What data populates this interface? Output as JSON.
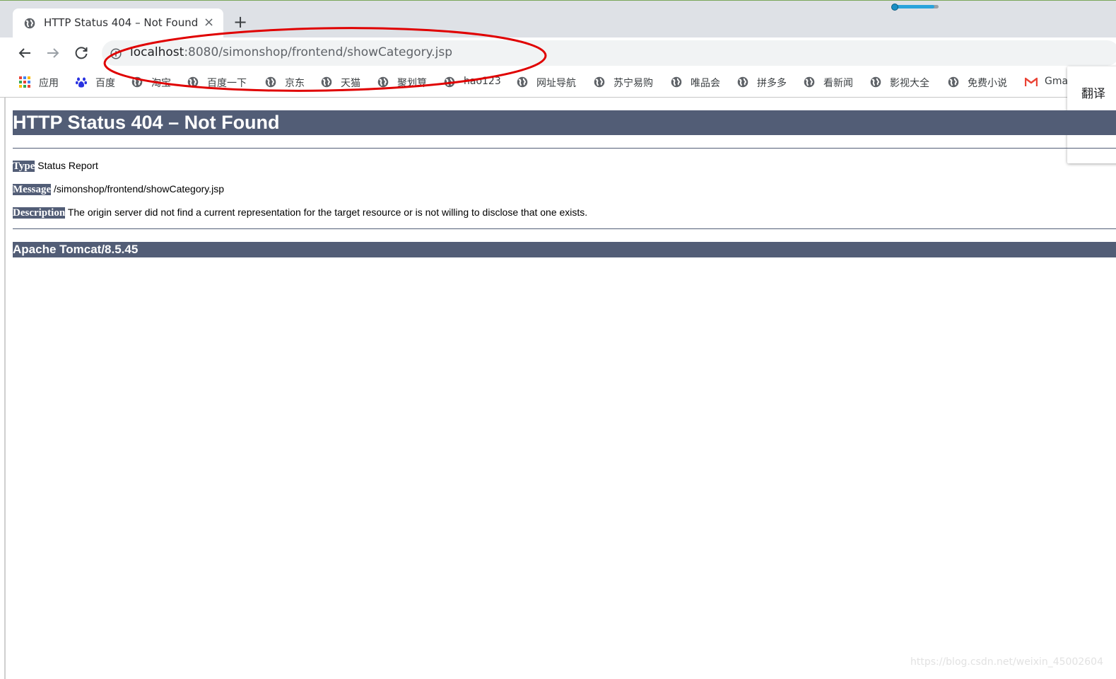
{
  "tab": {
    "title": "HTTP Status 404 – Not Found",
    "close": "×",
    "new_tab": "+"
  },
  "address": {
    "host": "localhost",
    "rest": ":8080/simonshop/frontend/showCategory.jsp"
  },
  "bookmarks": [
    {
      "label": "应用",
      "icon": "apps-grid-icon"
    },
    {
      "label": "百度",
      "icon": "baidu-paw-icon"
    },
    {
      "label": "淘宝",
      "icon": "globe-icon"
    },
    {
      "label": "百度一下",
      "icon": "globe-icon"
    },
    {
      "label": "京东",
      "icon": "globe-icon"
    },
    {
      "label": "天猫",
      "icon": "globe-icon"
    },
    {
      "label": "聚划算",
      "icon": "globe-icon"
    },
    {
      "label": "hao123",
      "icon": "globe-icon"
    },
    {
      "label": "网址导航",
      "icon": "globe-icon"
    },
    {
      "label": "苏宁易购",
      "icon": "globe-icon"
    },
    {
      "label": "唯品会",
      "icon": "globe-icon"
    },
    {
      "label": "拼多多",
      "icon": "globe-icon"
    },
    {
      "label": "看新闻",
      "icon": "globe-icon"
    },
    {
      "label": "影视大全",
      "icon": "globe-icon"
    },
    {
      "label": "免费小说",
      "icon": "globe-icon"
    },
    {
      "label": "Gmail",
      "icon": "gmail-icon"
    }
  ],
  "translate_popup": {
    "label": "翻译"
  },
  "page": {
    "heading": "HTTP Status 404 – Not Found",
    "type_label": "Type",
    "type_value": "Status Report",
    "message_label": "Message",
    "message_value": "/simonshop/frontend/showCategory.jsp",
    "description_label": "Description",
    "description_value": "The origin server did not find a current representation for the target resource or is not willing to disclose that one exists.",
    "footer": "Apache Tomcat/8.5.45"
  },
  "watermark": "https://blog.csdn.net/weixin_45002604",
  "colors": {
    "tomcat_header": "#525d76",
    "annotation": "#e00000"
  }
}
